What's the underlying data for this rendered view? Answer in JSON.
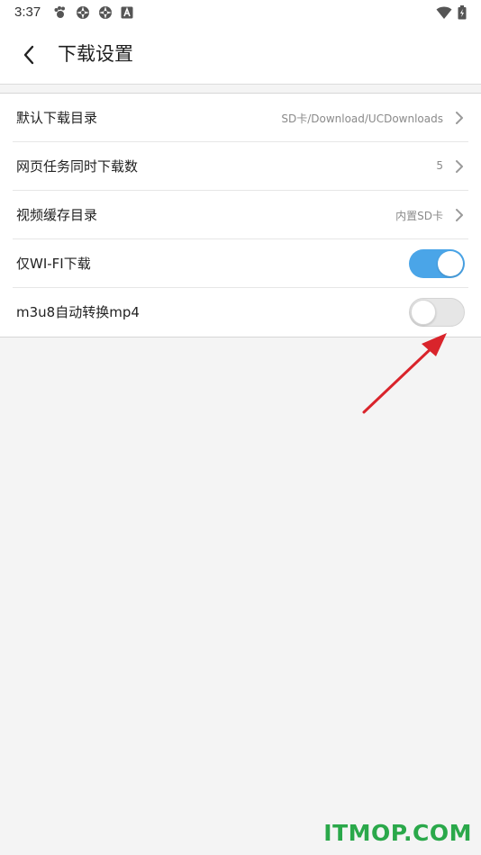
{
  "status_bar": {
    "time": "3:37",
    "left_icons": [
      "paw-icon",
      "gear-icon",
      "gear-icon",
      "a-box-icon"
    ],
    "right_icons": [
      "wifi-icon",
      "battery-icon"
    ]
  },
  "header": {
    "title": "下载设置",
    "back_icon": "chevron-left-icon"
  },
  "settings": [
    {
      "label": "默认下载目录",
      "value": "SD卡/Download/UCDownloads",
      "type": "link"
    },
    {
      "label": "网页任务同时下载数",
      "value": "5",
      "type": "link"
    },
    {
      "label": "视频缓存目录",
      "value": "内置SD卡",
      "type": "link"
    },
    {
      "label": "仅WI-FI下载",
      "type": "toggle",
      "checked": true
    },
    {
      "label": "m3u8自动转换mp4",
      "type": "toggle",
      "checked": false
    }
  ],
  "colors": {
    "toggle_on": "#4aa5e8",
    "toggle_off": "#e6e6e6",
    "annotation_arrow": "#d9242b",
    "watermark": "#2aa84a"
  },
  "watermark": "ITMOP.COM"
}
